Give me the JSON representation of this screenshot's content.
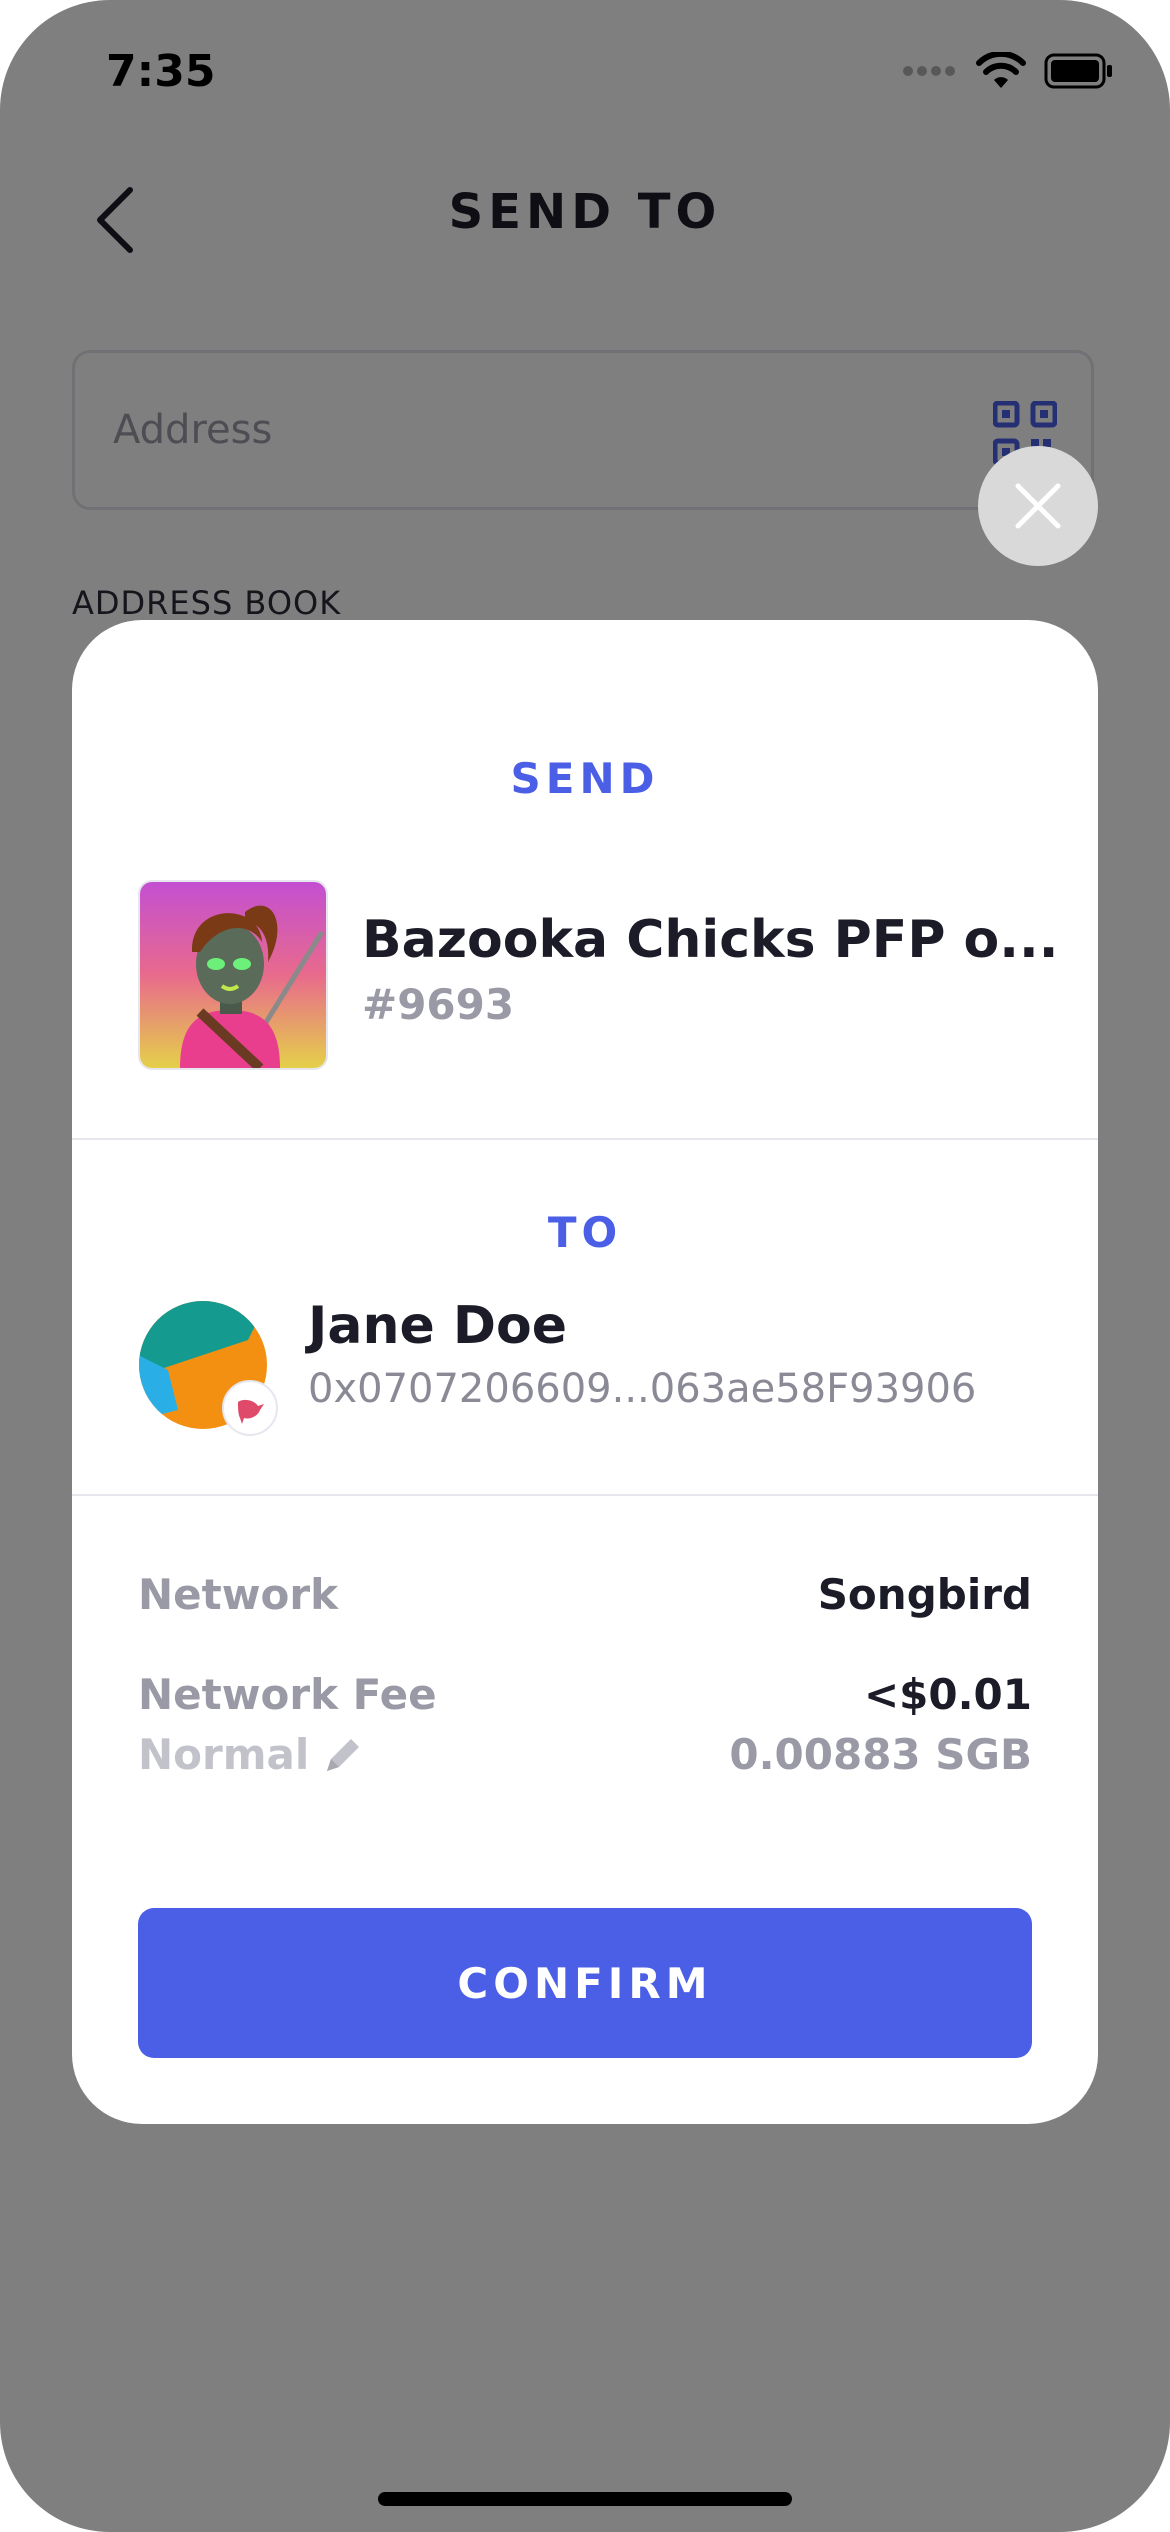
{
  "status_bar": {
    "time": "7:35"
  },
  "nav": {
    "title": "SEND TO"
  },
  "address": {
    "placeholder": "Address"
  },
  "address_book": {
    "label": "ADDRESS BOOK"
  },
  "sheet": {
    "send_label": "SEND",
    "nft": {
      "name": "Bazooka Chicks PFP o...",
      "id": "#9693"
    },
    "to_label": "TO",
    "recipient": {
      "name": "Jane Doe",
      "address": "0x0707206609...063ae58F93906"
    },
    "network": {
      "label": "Network",
      "value": "Songbird"
    },
    "fee": {
      "label": "Network Fee",
      "fiat": "<$0.01",
      "speed": "Normal",
      "native": "0.00883 SGB"
    },
    "confirm_label": "CONFIRM"
  },
  "colors": {
    "accent": "#4a5ee6",
    "overlay": "rgba(0,0,0,0.5)",
    "text_primary": "#1c1c28",
    "text_secondary": "#9a9aa6"
  },
  "icons": [
    "back-icon",
    "qr-code-icon",
    "close-icon",
    "pencil-icon",
    "songbird-network-icon",
    "wifi-icon",
    "battery-icon",
    "signal-icon"
  ]
}
